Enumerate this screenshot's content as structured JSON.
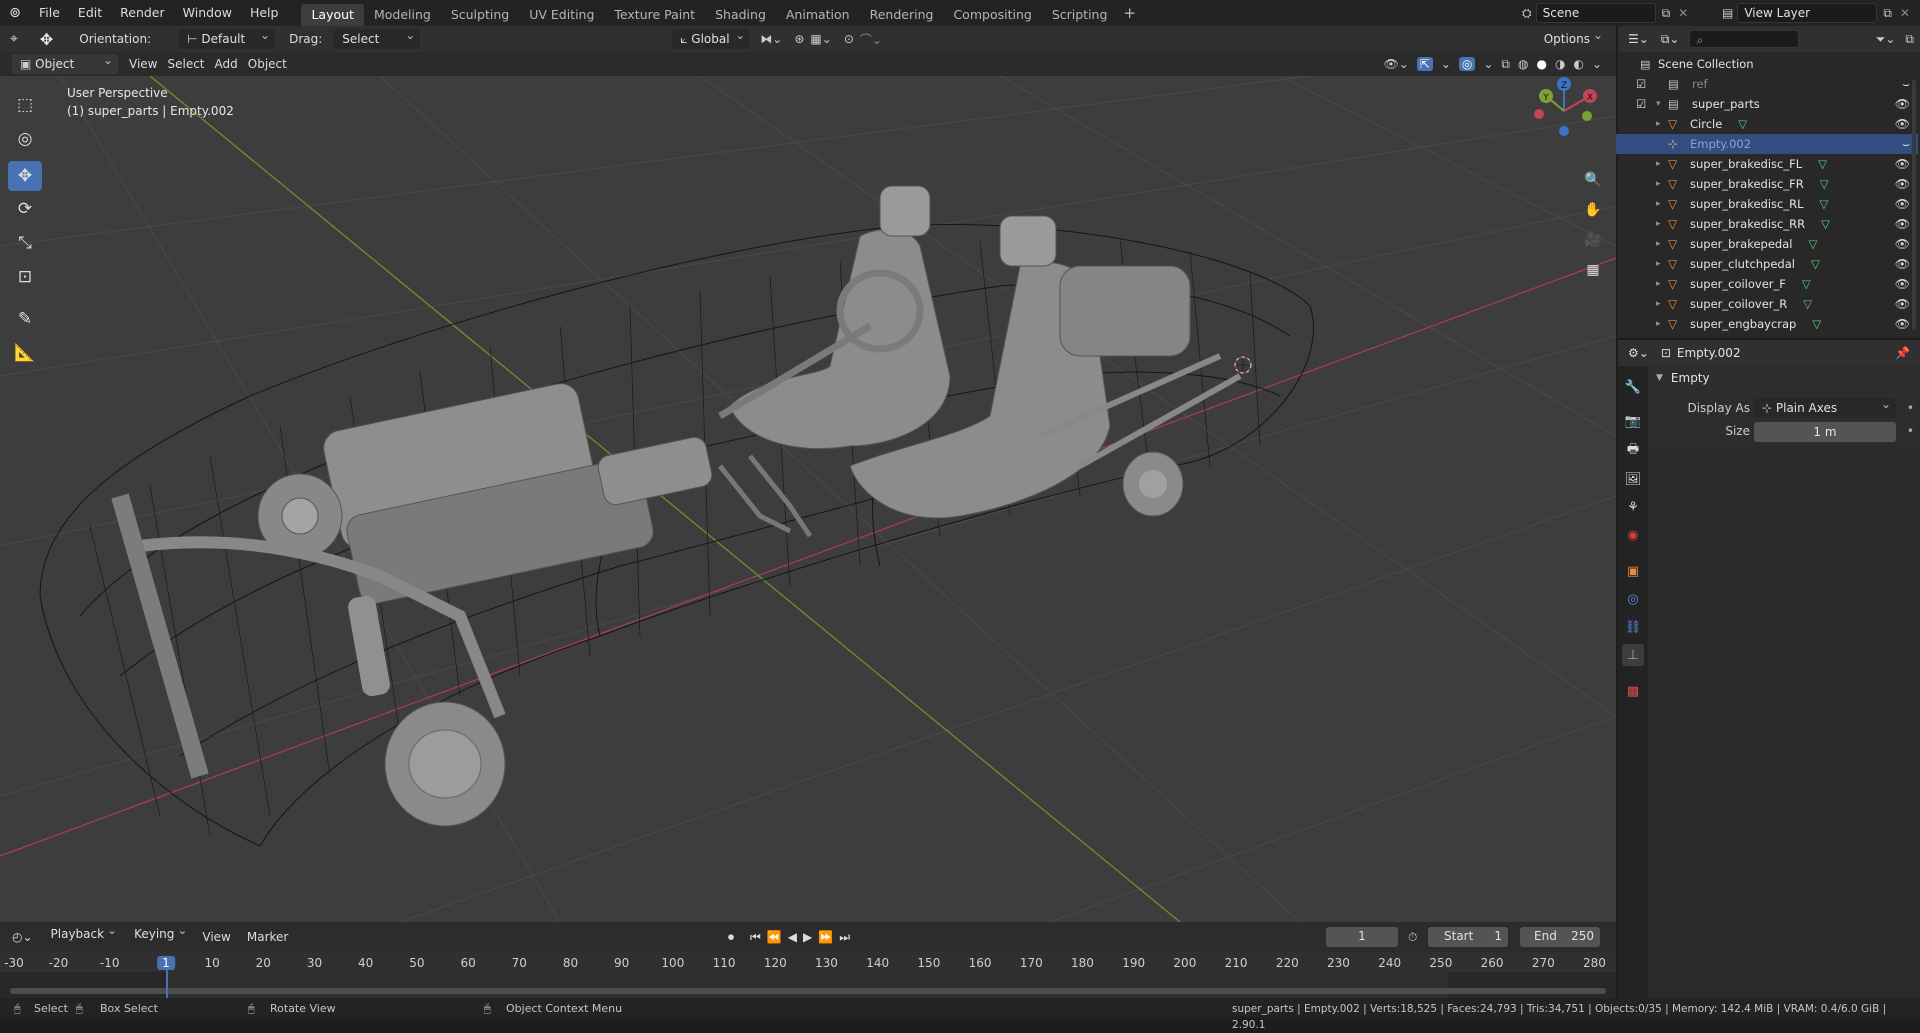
{
  "menus": [
    "File",
    "Edit",
    "Render",
    "Window",
    "Help"
  ],
  "workspaces": [
    "Layout",
    "Modeling",
    "Sculpting",
    "UV Editing",
    "Texture Paint",
    "Shading",
    "Animation",
    "Rendering",
    "Compositing",
    "Scripting"
  ],
  "add_workspace": "+",
  "scene": {
    "name": "Scene",
    "view_layer": "View Layer"
  },
  "tool_header": {
    "orientation_label": "Orientation:",
    "orientation_value": "Default",
    "drag_label": "Drag:",
    "drag_value": "Select Box",
    "transform_orientation": "Global",
    "options": "Options"
  },
  "viewport_header": {
    "mode": "Object Mode",
    "menus": [
      "View",
      "Select",
      "Add",
      "Object"
    ]
  },
  "viewport": {
    "view_name": "User Perspective",
    "context": "(1) super_parts | Empty.002",
    "gizmo": {
      "z": "Z",
      "y": "Y",
      "x": "X"
    }
  },
  "outliner": {
    "root": "Scene Collection",
    "rows": [
      {
        "name": "ref",
        "kind": "collection",
        "level": 1
      },
      {
        "name": "super_parts",
        "kind": "collection",
        "level": 1
      },
      {
        "name": "Circle",
        "kind": "mesh",
        "level": 2
      },
      {
        "name": "Empty.002",
        "kind": "empty",
        "level": 2,
        "selected": true
      },
      {
        "name": "super_brakedisc_FL",
        "kind": "mesh",
        "level": 2
      },
      {
        "name": "super_brakedisc_FR",
        "kind": "mesh",
        "level": 2
      },
      {
        "name": "super_brakedisc_RL",
        "kind": "mesh",
        "level": 2
      },
      {
        "name": "super_brakedisc_RR",
        "kind": "mesh",
        "level": 2
      },
      {
        "name": "super_brakepedal",
        "kind": "mesh",
        "level": 2
      },
      {
        "name": "super_clutchpedal",
        "kind": "mesh",
        "level": 2
      },
      {
        "name": "super_coilover_F",
        "kind": "mesh",
        "level": 2
      },
      {
        "name": "super_coilover_R",
        "kind": "mesh",
        "level": 2
      },
      {
        "name": "super_engbaycrap",
        "kind": "mesh",
        "level": 2
      }
    ]
  },
  "properties": {
    "object_name": "Empty.002",
    "panel_title": "Empty",
    "display_as_label": "Display As",
    "display_as_value": "Plain Axes",
    "size_label": "Size",
    "size_value": "1 m"
  },
  "timeline": {
    "menus": [
      "Playback",
      "Keying",
      "View",
      "Marker"
    ],
    "current_frame": "1",
    "start_label": "Start",
    "start": "1",
    "end_label": "End",
    "end": "250",
    "ruler": [
      "-30",
      "-20",
      "-10",
      "1",
      "10",
      "20",
      "30",
      "40",
      "50",
      "60",
      "70",
      "80",
      "90",
      "100",
      "110",
      "120",
      "130",
      "140",
      "150",
      "160",
      "170",
      "180",
      "190",
      "200",
      "210",
      "220",
      "230",
      "240",
      "250",
      "260",
      "270",
      "280"
    ]
  },
  "statusbar": {
    "select": "Select",
    "box_select": "Box Select",
    "rotate_view": "Rotate View",
    "context_menu": "Object Context Menu",
    "stats": "super_parts | Empty.002 | Verts:18,525 | Faces:24,793 | Tris:34,751 | Objects:0/35 | Memory: 142.4 MiB | VRAM: 0.4/6.0 GiB | 2.90.1"
  },
  "colors": {
    "accent": "#4772b3",
    "x_axis": "#c24655",
    "y_axis": "#7ea035",
    "mesh_icon": "#e88a3a",
    "active_object": "#334d80"
  }
}
